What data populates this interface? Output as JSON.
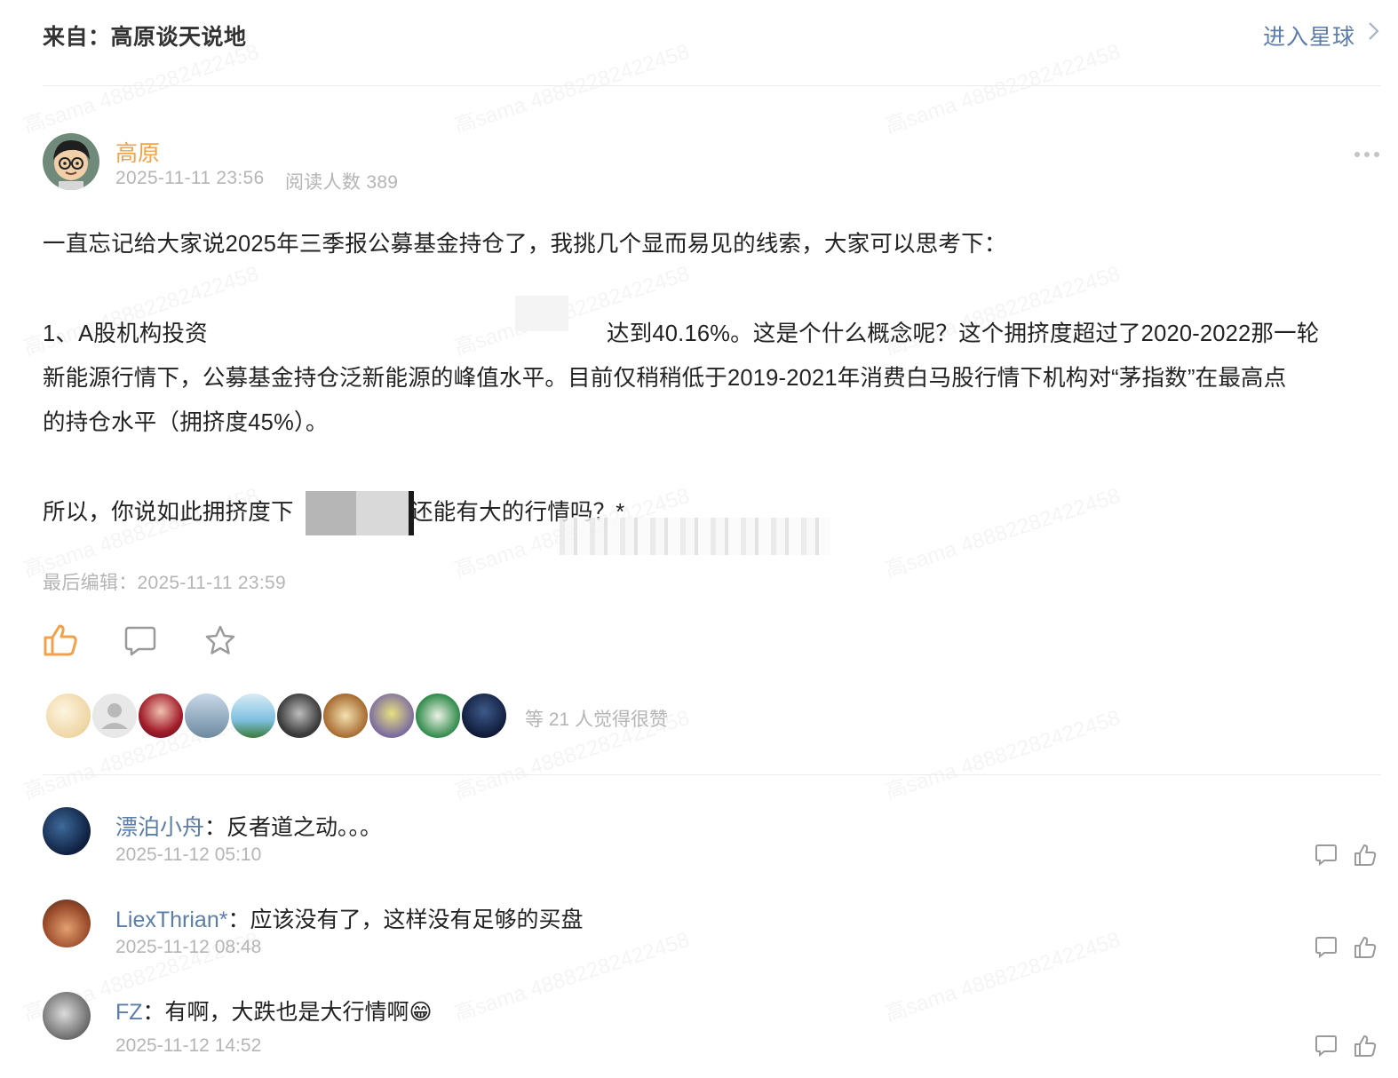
{
  "header": {
    "from_label": "来自：高原谈天说地",
    "enter_link": "进入星球"
  },
  "post": {
    "author": "高原",
    "timestamp": "2025-11-11 23:56",
    "readers": "阅读人数 389",
    "paragraphs": {
      "p1": "一直忘记给大家说2025年三季报公募基金持仓了，我挑几个显而易见的线索，大家可以思考下：",
      "p2_start": "1、A股机构投资",
      "p2_end": "达到40.16%。这是个什么概念呢？这个拥挤度超过了2020-2022那一轮",
      "p2_line2": "新能源行情下，公募基金持仓泛新能源的峰值水平。目前仅稍稍低于2019-2021年消费白马股行情下机构对“茅指数”在最高点",
      "p2_line3": "的持仓水平（拥挤度45%）。",
      "p3_start": "所以，你说如此拥挤度下",
      "p3_end": "还能有大的行情吗？*"
    },
    "last_edit": "最后编辑：2025-11-11 23:59",
    "likes_text": "等 21 人觉得很赞"
  },
  "comments": [
    {
      "user": "漂泊小舟",
      "text": "：反者道之动。。。",
      "time": "2025-11-12 05:10"
    },
    {
      "user": "LiexThrian*",
      "text": "：应该没有了，这样没有足够的买盘",
      "time": "2025-11-12 08:48"
    },
    {
      "user": "FZ",
      "text": "：有啊，大跌也是大行情啊😁",
      "time": "2025-11-12 14:52"
    }
  ],
  "watermark": "高sama 48882282422458",
  "colors": {
    "accent": "#f0a14a",
    "link": "#5b7da8",
    "muted": "#b5b5b5"
  }
}
